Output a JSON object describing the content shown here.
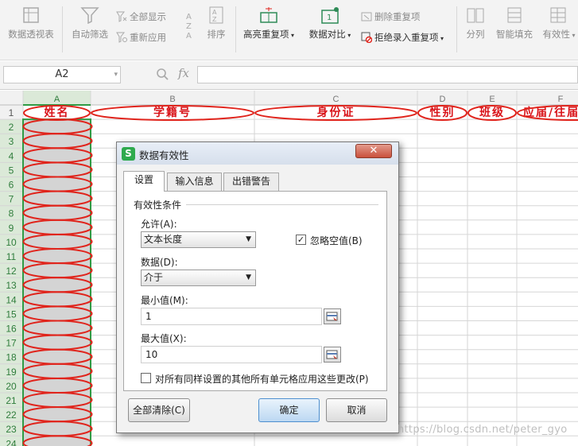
{
  "ribbon": {
    "pivot_table": "数据透视表",
    "auto_filter": "自动筛选",
    "show_all": "全部显示",
    "reapply": "重新应用",
    "sort": "排序",
    "highlight_duplicates": "高亮重复项",
    "data_compare": "数据对比",
    "remove_duplicates": "删除重复项",
    "reject_duplicates": "拒绝录入重复项",
    "split": "分列",
    "smart_fill": "智能填充",
    "validity": "有效性"
  },
  "formula_bar": {
    "name_box": "A2",
    "fx": "fx",
    "formula": ""
  },
  "sheet": {
    "columns": [
      "A",
      "B",
      "C",
      "D",
      "E",
      "F"
    ],
    "rows": [
      "1",
      "2",
      "3",
      "4",
      "5",
      "6",
      "7",
      "8",
      "9",
      "10",
      "11",
      "12",
      "13",
      "14",
      "15",
      "16",
      "17",
      "18",
      "19",
      "20",
      "21",
      "22",
      "23",
      "24"
    ],
    "headers": [
      "姓名",
      "学籍号",
      "身份证",
      "性别",
      "班级",
      "应届/往届"
    ]
  },
  "dialog": {
    "title": "数据有效性",
    "close": "✕",
    "tabs": [
      "设置",
      "输入信息",
      "出错警告"
    ],
    "group_label": "有效性条件",
    "allow_label": "允许(A):",
    "allow_value": "文本长度",
    "ignore_blank_label": "忽略空值(B)",
    "ignore_blank_checked": true,
    "data_label": "数据(D):",
    "data_value": "介于",
    "min_label": "最小值(M):",
    "min_value": "1",
    "max_label": "最大值(X):",
    "max_value": "10",
    "apply_all_label": "对所有同样设置的其他所有单元格应用这些更改(P)",
    "apply_all_checked": false,
    "clear_all": "全部清除(C)",
    "ok": "确定",
    "cancel": "取消"
  },
  "watermark": "https://blog.csdn.net/peter_gyo",
  "colors": {
    "annotation_red": "#e0241c",
    "header_text_red": "#d9141a",
    "selected_column": "#d4d4d4",
    "selection_border": "#2f9b45"
  }
}
